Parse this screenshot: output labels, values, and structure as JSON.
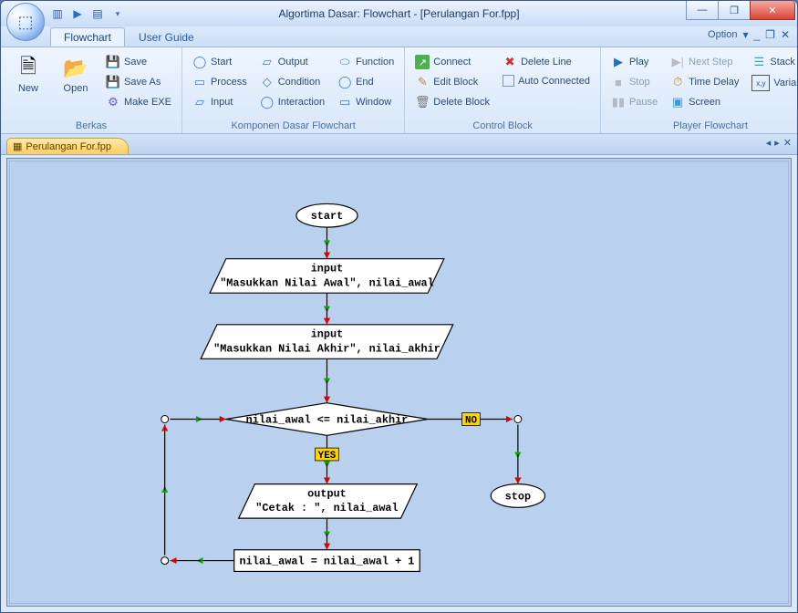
{
  "window": {
    "title": "Algortima Dasar: Flowchart - [Perulangan For.fpp]"
  },
  "tabs": {
    "flowchart": "Flowchart",
    "userguide": "User Guide",
    "option": "Option"
  },
  "ribbon": {
    "berkas": {
      "label": "Berkas",
      "new": "New",
      "open": "Open",
      "save": "Save",
      "saveas": "Save As",
      "makeexe": "Make EXE"
    },
    "komponen": {
      "label": "Komponen Dasar Flowchart",
      "start": "Start",
      "process": "Process",
      "input": "Input",
      "output": "Output",
      "condition": "Condition",
      "interaction": "Interaction",
      "function": "Function",
      "end": "End",
      "window": "Window"
    },
    "control": {
      "label": "Control Block",
      "connect": "Connect",
      "editblock": "Edit Block",
      "deleteblock": "Delete Block",
      "deleteline": "Delete Line",
      "autoconnected": "Auto Connected"
    },
    "player": {
      "label": "Player Flowchart",
      "play": "Play",
      "stop": "Stop",
      "pause": "Pause",
      "nextstep": "Next Step",
      "timedelay": "Time Delay",
      "screen": "Screen",
      "stack": "Stack",
      "variable": "Variable"
    }
  },
  "doctab": {
    "filename": "Perulangan For.fpp"
  },
  "flow": {
    "start": "start",
    "input1_l1": "input",
    "input1_l2": "\"Masukkan Nilai Awal\", nilai_awal",
    "input2_l1": "input",
    "input2_l2": "\"Masukkan Nilai Akhir\", nilai_akhir",
    "cond": "nilai_awal <= nilai_akhir",
    "yes": "YES",
    "no": "NO",
    "output_l1": "output",
    "output_l2": "\"Cetak : \", nilai_awal",
    "process": "nilai_awal = nilai_awal + 1",
    "stop": "stop"
  }
}
